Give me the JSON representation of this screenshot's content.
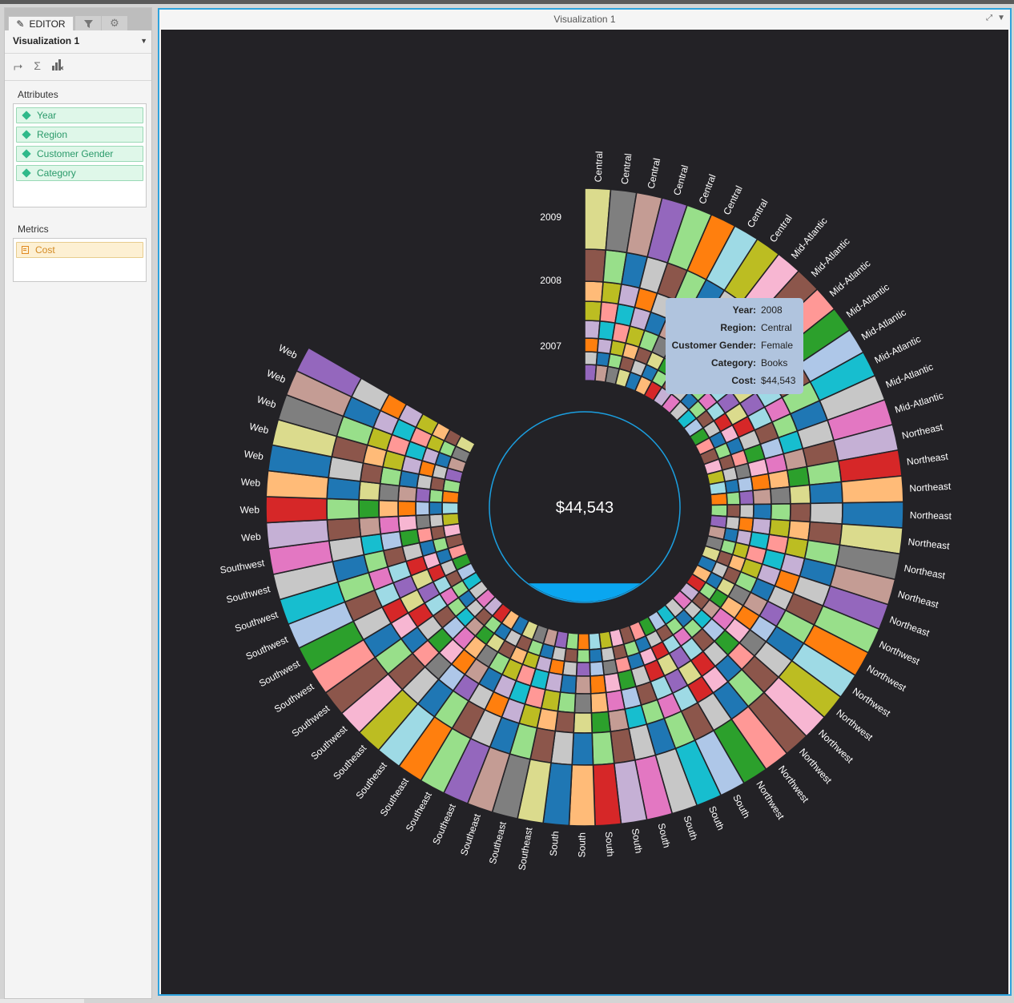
{
  "editor": {
    "tab_label": "EDITOR",
    "visualization_name": "Visualization 1",
    "attributes_label": "Attributes",
    "metrics_label": "Metrics",
    "attributes": [
      "Year",
      "Region",
      "Customer Gender",
      "Category"
    ],
    "metrics": [
      "Cost"
    ]
  },
  "viz": {
    "title": "Visualization 1"
  },
  "chart_data": {
    "type": "sunburst",
    "center_value": "$44,543",
    "center_fill_fraction": 0.1,
    "years": [
      "2009",
      "2008",
      "2007"
    ],
    "regions_outer_labels": [
      "Central",
      "Central",
      "Central",
      "Central",
      "Central",
      "Central",
      "Central",
      "Central",
      "Mid-Atlantic",
      "Mid-Atlantic",
      "Mid-Atlantic",
      "Mid-Atlantic",
      "Mid-Atlantic",
      "Mid-Atlantic",
      "Mid-Atlantic",
      "Mid-Atlantic",
      "Northeast",
      "Northeast",
      "Northeast",
      "Northeast",
      "Northeast",
      "Northeast",
      "Northeast",
      "Northeast",
      "Northwest",
      "Northwest",
      "Northwest",
      "Northwest",
      "Northwest",
      "Northwest",
      "Northwest",
      "Northwest",
      "South",
      "South",
      "South",
      "South",
      "South",
      "South",
      "South",
      "South",
      "Southeast",
      "Southeast",
      "Southeast",
      "Southeast",
      "Southeast",
      "Southeast",
      "Southeast",
      "Southeast",
      "Southwest",
      "Southwest",
      "Southwest",
      "Southwest",
      "Southwest",
      "Southwest",
      "Southwest",
      "Southwest",
      "Web",
      "Web",
      "Web",
      "Web",
      "Web",
      "Web",
      "Web",
      "Web"
    ],
    "palette": [
      "#9467bd",
      "#c5b0d5",
      "#8c564b",
      "#c49c94",
      "#e377c2",
      "#f7b6d2",
      "#7f7f7f",
      "#c7c7c7",
      "#bcbd22",
      "#dbdb8d",
      "#17becf",
      "#9edae5",
      "#1f77b4",
      "#aec7e8",
      "#ff7f0e",
      "#ffbb78",
      "#2ca02c",
      "#98df8a",
      "#d62728",
      "#ff9896"
    ],
    "tooltip": {
      "rows": [
        {
          "label": "Year:",
          "value": "2008"
        },
        {
          "label": "Region:",
          "value": "Central"
        },
        {
          "label": "Customer Gender:",
          "value": "Female"
        },
        {
          "label": "Category:",
          "value": "Books"
        },
        {
          "label": "Cost:",
          "value": "$44,543"
        }
      ]
    }
  }
}
